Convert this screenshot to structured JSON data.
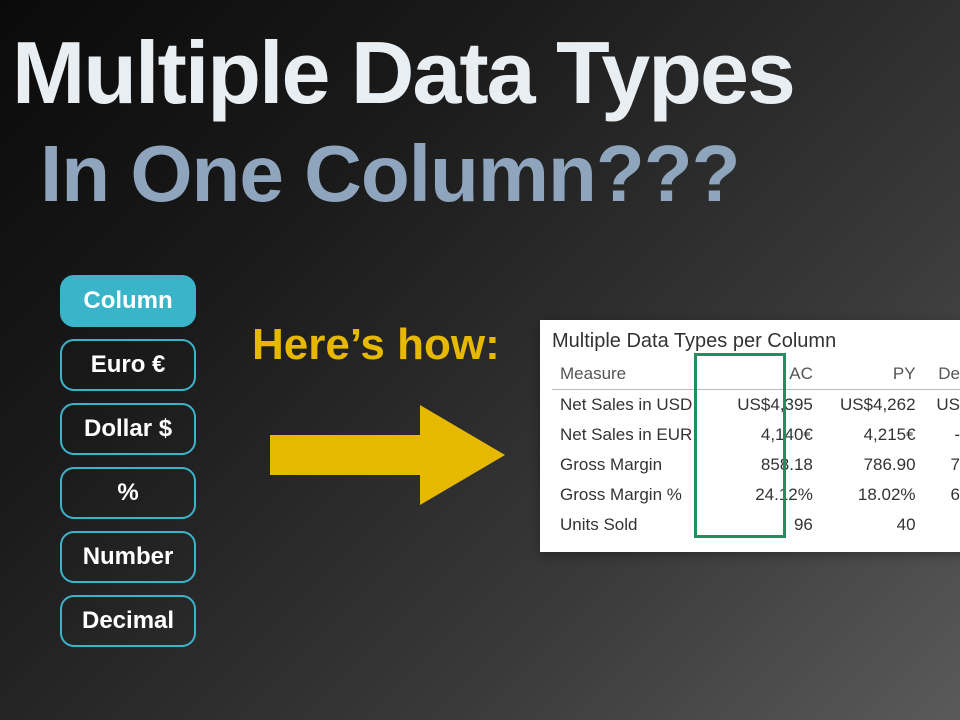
{
  "title": {
    "main": "Multiple Data Types",
    "sub": "In One Column???"
  },
  "pills": [
    {
      "label": "Column",
      "active": true
    },
    {
      "label": "Euro €",
      "active": false
    },
    {
      "label": "Dollar $",
      "active": false
    },
    {
      "label": "%",
      "active": false
    },
    {
      "label": "Number",
      "active": false
    },
    {
      "label": "Decimal",
      "active": false
    }
  ],
  "hint": "Here’s how:",
  "table": {
    "title": "Multiple Data Types per Column",
    "headers": [
      "Measure",
      "AC",
      "PY",
      "De"
    ],
    "rows": [
      {
        "measure": "Net Sales in USD",
        "ac": "US$4,395",
        "py": "US$4,262",
        "de": "US"
      },
      {
        "measure": "Net Sales in EUR",
        "ac": "4,140€",
        "py": "4,215€",
        "de": "-"
      },
      {
        "measure": "Gross Margin",
        "ac": "858.18",
        "py": "786.90",
        "de": "7"
      },
      {
        "measure": "Gross Margin %",
        "ac": "24.12%",
        "py": "18.02%",
        "de": "6"
      },
      {
        "measure": "Units Sold",
        "ac": "96",
        "py": "40",
        "de": ""
      }
    ]
  },
  "colors": {
    "accent_teal": "#3ab4c9",
    "accent_yellow": "#e6b800",
    "highlight_green": "#1e8f5e"
  }
}
